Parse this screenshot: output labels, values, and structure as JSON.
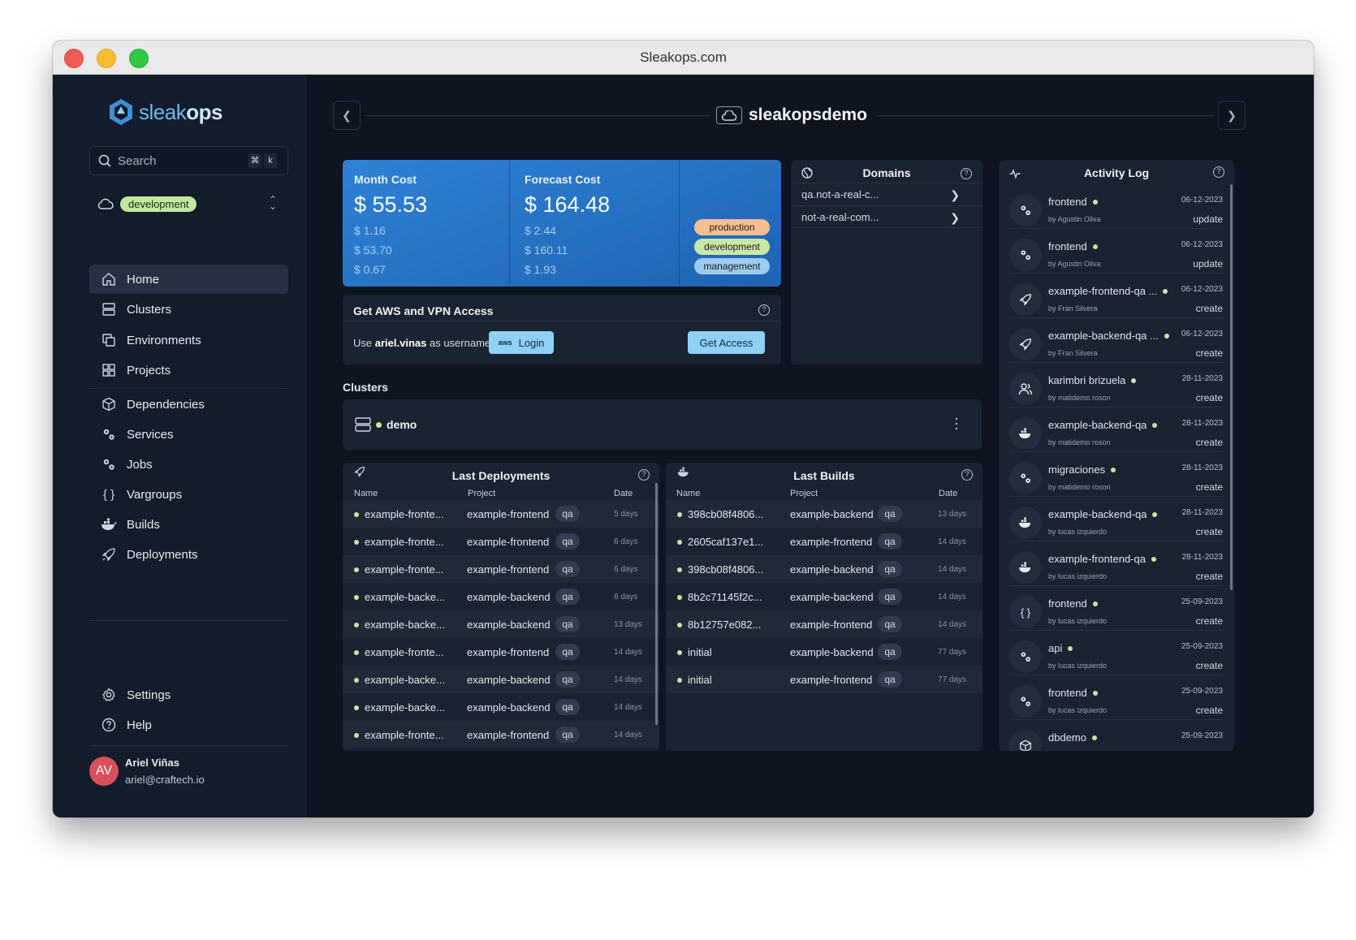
{
  "window": {
    "title": "Sleakops.com"
  },
  "brand": {
    "name_light": "sleak",
    "name_bold": "ops"
  },
  "search": {
    "placeholder": "Search",
    "key1": "⌘",
    "key2": "k"
  },
  "environment": {
    "selected": "development"
  },
  "nav": {
    "main": [
      {
        "label": "Home",
        "icon": "home-icon"
      },
      {
        "label": "Clusters",
        "icon": "clusters-icon"
      },
      {
        "label": "Environments",
        "icon": "environments-icon"
      },
      {
        "label": "Projects",
        "icon": "projects-icon"
      }
    ],
    "secondary": [
      {
        "label": "Dependencies",
        "icon": "dependencies-icon"
      },
      {
        "label": "Services",
        "icon": "services-icon"
      },
      {
        "label": "Jobs",
        "icon": "jobs-icon"
      },
      {
        "label": "Vargroups",
        "icon": "vargroups-icon"
      },
      {
        "label": "Builds",
        "icon": "builds-icon"
      },
      {
        "label": "Deployments",
        "icon": "deployments-icon"
      }
    ],
    "bottom": [
      {
        "label": "Settings",
        "icon": "settings-icon"
      },
      {
        "label": "Help",
        "icon": "help-icon"
      }
    ]
  },
  "user": {
    "initials": "AV",
    "name": "Ariel Viñas",
    "email": "ariel@craftech.io"
  },
  "project": {
    "title": "sleakopsdemo"
  },
  "costs": {
    "month": {
      "label": "Month Cost",
      "total": "$ 55.53",
      "breakdown": [
        "$ 1.16",
        "$ 53.70",
        "$ 0.67"
      ]
    },
    "forecast": {
      "label": "Forecast Cost",
      "total": "$ 164.48",
      "breakdown": [
        "$ 2.44",
        "$ 160.11",
        "$ 1.93"
      ]
    },
    "envs": [
      {
        "label": "production",
        "color": "#f6bf93"
      },
      {
        "label": "development",
        "color": "#c9e6a6"
      },
      {
        "label": "management",
        "color": "#9ecbf1"
      }
    ]
  },
  "aws": {
    "title": "Get AWS and VPN Access",
    "use": "Use",
    "username": "ariel.vinas",
    "as_username": "as username",
    "login_aws": "aws",
    "login_label": "Login",
    "access_label": "Get Access"
  },
  "domains": {
    "title": "Domains",
    "items": [
      "qa.not-a-real-c...",
      "not-a-real-com..."
    ]
  },
  "clusters": {
    "title": "Clusters",
    "items": [
      {
        "name": "demo"
      }
    ]
  },
  "deployments": {
    "title": "Last Deployments",
    "headers": {
      "name": "Name",
      "project": "Project",
      "date": "Date"
    },
    "rows": [
      {
        "name": "example-fronte...",
        "project": "example-frontend",
        "env": "qa",
        "date": "5 days"
      },
      {
        "name": "example-fronte...",
        "project": "example-frontend",
        "env": "qa",
        "date": "6 days"
      },
      {
        "name": "example-fronte...",
        "project": "example-frontend",
        "env": "qa",
        "date": "6 days"
      },
      {
        "name": "example-backe...",
        "project": "example-backend",
        "env": "qa",
        "date": "6 days"
      },
      {
        "name": "example-backe...",
        "project": "example-backend",
        "env": "qa",
        "date": "13 days"
      },
      {
        "name": "example-fronte...",
        "project": "example-frontend",
        "env": "qa",
        "date": "14 days"
      },
      {
        "name": "example-backe...",
        "project": "example-backend",
        "env": "qa",
        "date": "14 days"
      },
      {
        "name": "example-backe...",
        "project": "example-backend",
        "env": "qa",
        "date": "14 days"
      },
      {
        "name": "example-fronte...",
        "project": "example-frontend",
        "env": "qa",
        "date": "14 days"
      }
    ]
  },
  "builds": {
    "title": "Last Builds",
    "headers": {
      "name": "Name",
      "project": "Project",
      "date": "Date"
    },
    "rows": [
      {
        "name": "398cb08f4806...",
        "project": "example-backend",
        "env": "qa",
        "date": "13 days"
      },
      {
        "name": "2605caf137e1...",
        "project": "example-frontend",
        "env": "qa",
        "date": "14 days"
      },
      {
        "name": "398cb08f4806...",
        "project": "example-backend",
        "env": "qa",
        "date": "14 days"
      },
      {
        "name": "8b2c71145f2c...",
        "project": "example-backend",
        "env": "qa",
        "date": "14 days"
      },
      {
        "name": "8b12757e082...",
        "project": "example-frontend",
        "env": "qa",
        "date": "14 days"
      },
      {
        "name": "initial",
        "project": "example-backend",
        "env": "qa",
        "date": "77 days"
      },
      {
        "name": "initial",
        "project": "example-frontend",
        "env": "qa",
        "date": "77 days"
      }
    ]
  },
  "activity": {
    "title": "Activity Log",
    "items": [
      {
        "name": "frontend",
        "by": "by Agustin Oliva",
        "date": "06-12-2023",
        "verb": "update",
        "icon": "services-icon"
      },
      {
        "name": "frontend",
        "by": "by Agustin Oliva",
        "date": "06-12-2023",
        "verb": "update",
        "icon": "services-icon"
      },
      {
        "name": "example-frontend-qa ...",
        "by": "by Fran Silvera",
        "date": "06-12-2023",
        "verb": "create",
        "icon": "deployments-icon"
      },
      {
        "name": "example-backend-qa ...",
        "by": "by Fran Silvera",
        "date": "06-12-2023",
        "verb": "create",
        "icon": "deployments-icon"
      },
      {
        "name": "karimbri brizuela",
        "by": "by matidemo roson",
        "date": "28-11-2023",
        "verb": "create",
        "icon": "users-icon"
      },
      {
        "name": "example-backend-qa",
        "by": "by matidemo roson",
        "date": "28-11-2023",
        "verb": "create",
        "icon": "builds-icon"
      },
      {
        "name": "migraciones",
        "by": "by matidemo roson",
        "date": "28-11-2023",
        "verb": "create",
        "icon": "services-icon"
      },
      {
        "name": "example-backend-qa",
        "by": "by lucas izquierdo",
        "date": "28-11-2023",
        "verb": "create",
        "icon": "builds-icon"
      },
      {
        "name": "example-frontend-qa",
        "by": "by lucas izquierdo",
        "date": "28-11-2023",
        "verb": "create",
        "icon": "builds-icon"
      },
      {
        "name": "frontend",
        "by": "by lucas izquierdo",
        "date": "25-09-2023",
        "verb": "create",
        "icon": "vargroups-icon"
      },
      {
        "name": "api",
        "by": "by lucas izquierdo",
        "date": "25-09-2023",
        "verb": "create",
        "icon": "services-icon"
      },
      {
        "name": "frontend",
        "by": "by lucas izquierdo",
        "date": "25-09-2023",
        "verb": "create",
        "icon": "services-icon"
      },
      {
        "name": "dbdemo",
        "by": "",
        "date": "25-09-2023",
        "verb": "",
        "icon": "dependencies-icon"
      }
    ]
  }
}
